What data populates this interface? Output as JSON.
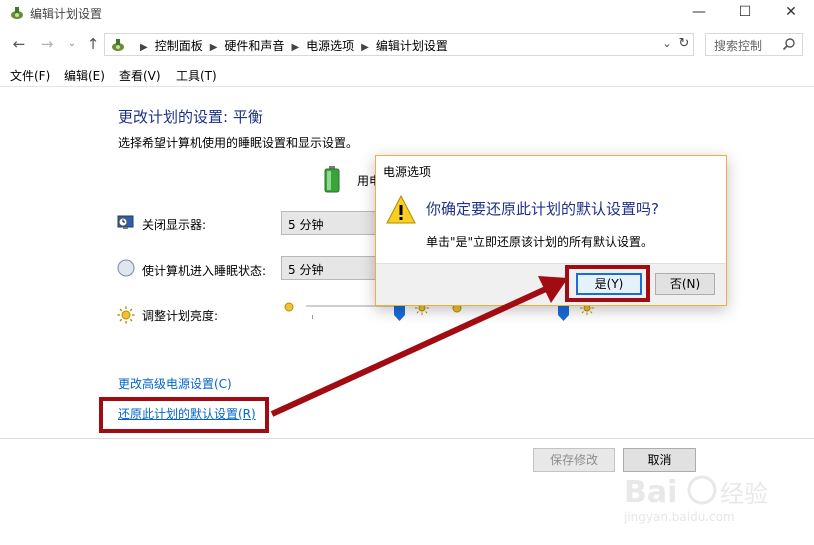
{
  "window": {
    "title": "编辑计划设置",
    "min_label": "—",
    "max_label": "☐",
    "close_label": "✕"
  },
  "nav": {
    "back": "←",
    "forward": "→",
    "recent": "⌄",
    "up": "↑",
    "breadcrumbs": [
      "控制面板",
      "硬件和声音",
      "电源选项",
      "编辑计划设置"
    ],
    "search_placeholder": "搜索控制"
  },
  "menu": [
    "文件(F)",
    "编辑(E)",
    "查看(V)",
    "工具(T)"
  ],
  "content": {
    "title": "更改计划的设置: 平衡",
    "subtitle": "选择希望计算机使用的睡眠设置和显示设置。",
    "plugged_label": "用电",
    "rows": [
      {
        "label": "关闭显示器:",
        "value": "5 分钟"
      },
      {
        "label": "使计算机进入睡眠状态:",
        "value": "5 分钟"
      },
      {
        "label": "调整计划亮度:"
      }
    ],
    "link_advanced": "更改高级电源设置(C)",
    "link_restore": "还原此计划的默认设置(R)",
    "save_label": "保存修改",
    "cancel_label": "取消"
  },
  "dialog": {
    "title": "电源选项",
    "question": "你确定要还原此计划的默认设置吗?",
    "detail": "单击\"是\"立即还原该计划的所有默认设置。",
    "yes_label": "是(Y)",
    "no_label": "否(N)"
  },
  "watermark": {
    "text": "jingyan.baidu.com"
  },
  "colors": {
    "accent": "#1e3287",
    "link": "#0066cc",
    "highlight": "#a10b12",
    "dialog_border": "#e7b33a"
  }
}
